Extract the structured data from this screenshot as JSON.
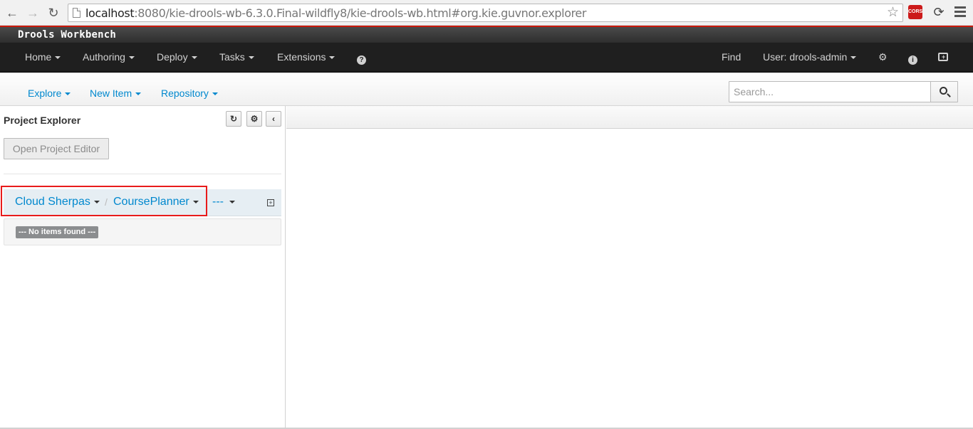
{
  "browser": {
    "url_host": "localhost",
    "url_rest": ":8080/kie-drools-wb-6.3.0.Final-wildfly8/kie-drools-wb.html#org.kie.guvnor.explorer",
    "extension_label": "CORS"
  },
  "app": {
    "title": "Drools Workbench"
  },
  "main_nav": {
    "items": [
      {
        "label": "Home"
      },
      {
        "label": "Authoring"
      },
      {
        "label": "Deploy"
      },
      {
        "label": "Tasks"
      },
      {
        "label": "Extensions"
      }
    ],
    "help_glyph": "?",
    "find_label": "Find",
    "user_label": "User: drools-admin"
  },
  "sub_nav": {
    "items": [
      {
        "label": "Explore"
      },
      {
        "label": "New Item"
      },
      {
        "label": "Repository"
      }
    ],
    "search_placeholder": "Search..."
  },
  "explorer": {
    "title": "Project Explorer",
    "open_editor_label": "Open Project Editor",
    "breadcrumbs": {
      "organizational_unit": "Cloud Sherpas",
      "repository": "CoursePlanner",
      "branch": "---",
      "separator": "/"
    },
    "empty_message": "--- No items found ---"
  },
  "colors": {
    "accent": "#0088ce",
    "highlight_box": "#e81b1b",
    "nav_background": "#1f1f1f"
  }
}
